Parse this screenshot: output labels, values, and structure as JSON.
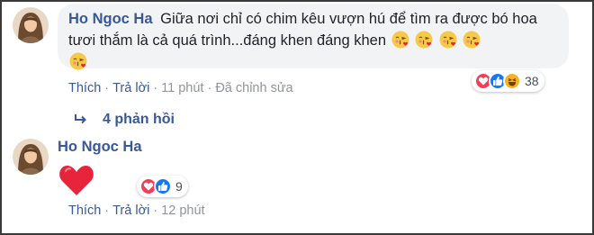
{
  "comment1": {
    "author": "Ho Ngoc Ha",
    "text": "Giữa nơi chỉ có chim kêu vượn hú để tìm ra được bó hoa tươi thắm là cả quá trình...đáng khen đáng khen",
    "emoji_names": [
      "kissing-heart-emoji",
      "kissing-heart-emoji",
      "kissing-heart-emoji",
      "kissing-heart-emoji",
      "kissing-heart-emoji"
    ],
    "reactions": {
      "count": "38",
      "icons": [
        "love-icon",
        "like-icon",
        "haha-icon"
      ]
    },
    "actions": {
      "like": "Thích",
      "reply": "Trả lời",
      "time": "11 phút",
      "edited": "Đã chỉnh sửa"
    }
  },
  "replies": {
    "label": "4 phản hồi"
  },
  "comment2": {
    "author": "Ho Ngoc Ha",
    "sticker": "red-heart-icon",
    "reactions": {
      "count": "9",
      "icons": [
        "love-icon",
        "like-icon"
      ]
    },
    "actions": {
      "like": "Thích",
      "reply": "Trả lời",
      "time": "12 phút"
    }
  },
  "colors": {
    "link": "#385898",
    "bubble": "#f2f3f5",
    "love": "#f33e58",
    "like": "#1877f2",
    "haha": "#f7b125",
    "muted": "#90949c"
  }
}
